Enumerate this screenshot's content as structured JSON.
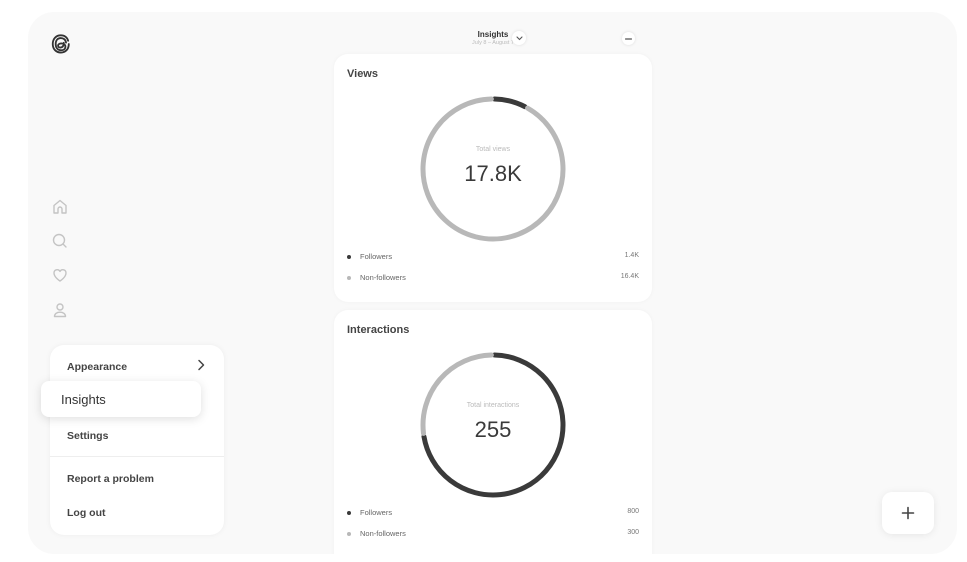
{
  "header": {
    "title": "Insights",
    "date_range": "July 8 – August 7",
    "chevron_icon": "chevron-down-icon",
    "more_icon": "more-horizontal-icon"
  },
  "sidebar": {
    "logo_icon": "threads-logo-icon",
    "nav": [
      {
        "name": "home",
        "icon": "home-icon"
      },
      {
        "name": "search",
        "icon": "search-icon"
      },
      {
        "name": "activity",
        "icon": "heart-icon"
      },
      {
        "name": "profile",
        "icon": "user-icon"
      }
    ]
  },
  "menu": {
    "items": [
      {
        "label": "Appearance",
        "has_submenu": true
      },
      {
        "label": "Insights",
        "highlighted": true
      },
      {
        "label": "Settings"
      },
      {
        "label": "Report a problem"
      },
      {
        "label": "Log out"
      }
    ]
  },
  "cards": {
    "views": {
      "title": "Views",
      "center_label": "Total views",
      "center_value": "17.8K",
      "legend": [
        {
          "label": "Followers",
          "value": "1.4K",
          "color": "#3a3a3a"
        },
        {
          "label": "Non-followers",
          "value": "16.4K",
          "color": "#b8b8b8"
        }
      ]
    },
    "interactions": {
      "title": "Interactions",
      "center_label": "Total interactions",
      "center_value": "255",
      "legend": [
        {
          "label": "Followers",
          "value": "800",
          "color": "#3a3a3a"
        },
        {
          "label": "Non-followers",
          "value": "300",
          "color": "#b8b8b8"
        }
      ]
    }
  },
  "fab": {
    "icon": "plus-icon",
    "label": "+"
  },
  "chart_data": [
    {
      "type": "pie",
      "title": "Views",
      "categories": [
        "Followers",
        "Non-followers"
      ],
      "values": [
        1400,
        16400
      ],
      "colors": [
        "#3a3a3a",
        "#b8b8b8"
      ],
      "center_label": "Total views",
      "center_value": "17.8K"
    },
    {
      "type": "pie",
      "title": "Interactions",
      "categories": [
        "Followers",
        "Non-followers"
      ],
      "values": [
        800,
        300
      ],
      "colors": [
        "#3a3a3a",
        "#b8b8b8"
      ],
      "center_label": "Total interactions",
      "center_value": "255"
    }
  ]
}
